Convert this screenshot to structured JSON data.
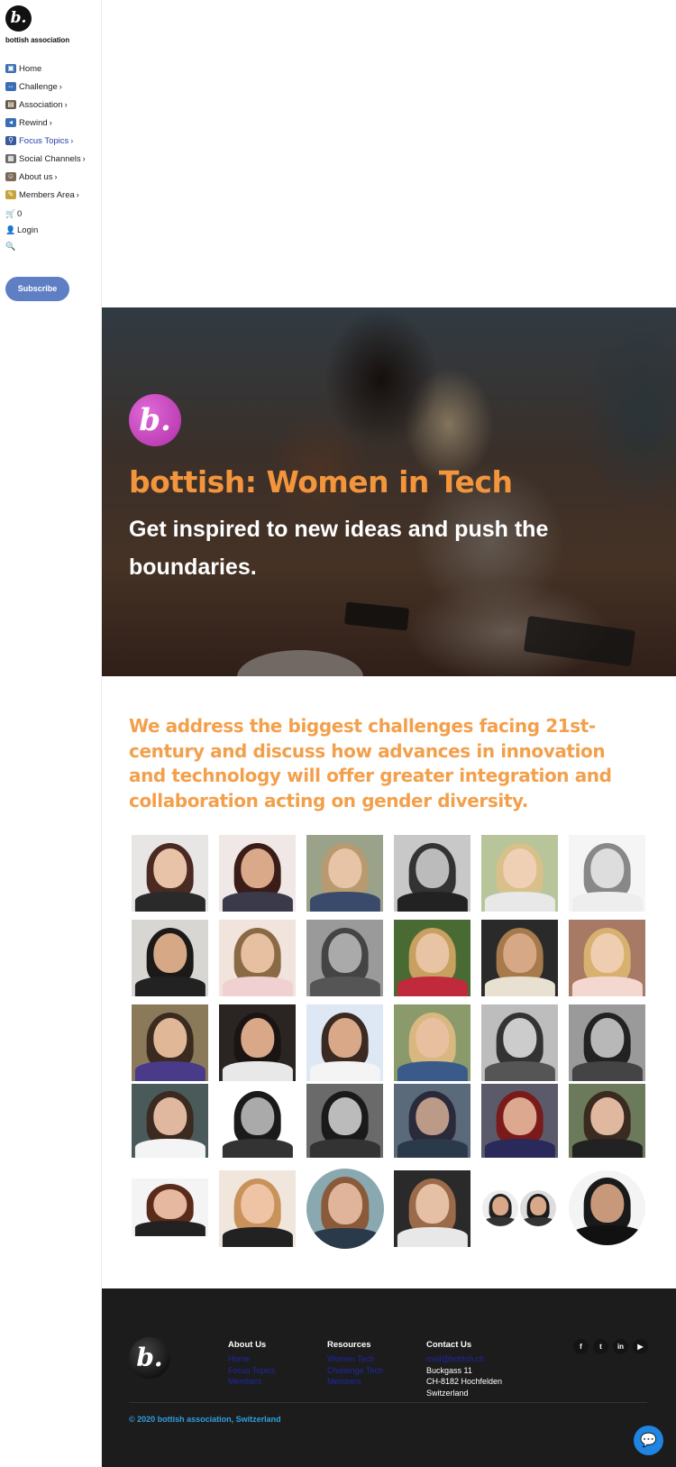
{
  "sidebar": {
    "logo_letter": "b.",
    "brand": "bottish association",
    "nav": [
      {
        "label": "Home",
        "icon": "home-icon",
        "color": "#3a6fb5",
        "chev": false,
        "active": false
      },
      {
        "label": "Challenge",
        "icon": "challenge-icon",
        "color": "#3a6fb5",
        "chev": true,
        "active": false
      },
      {
        "label": "Association",
        "icon": "association-icon",
        "color": "#6a5a4a",
        "chev": true,
        "active": false
      },
      {
        "label": "Rewind",
        "icon": "rewind-icon",
        "color": "#3a6fb5",
        "chev": true,
        "active": false
      },
      {
        "label": "Focus Topics",
        "icon": "magnifier-icon",
        "color": "#3a5a9a",
        "chev": true,
        "active": true
      },
      {
        "label": "Social Channels",
        "icon": "social-icon",
        "color": "#6a6a6a",
        "chev": true,
        "active": false
      },
      {
        "label": "About us",
        "icon": "about-icon",
        "color": "#7a6a5a",
        "chev": true,
        "active": false
      },
      {
        "label": "Members Area",
        "icon": "members-icon",
        "color": "#c8a23a",
        "chev": true,
        "active": false
      }
    ],
    "cart_count": "0",
    "login_label": "Login",
    "subscribe_label": "Subscribe"
  },
  "hero": {
    "logo_letter": "b.",
    "title": "bottish: Women in Tech",
    "subtitle": "Get inspired to new ideas and push the boundaries."
  },
  "mission": "We address the biggest challenges facing 21st-century and discuss how advances in innovation and technology will offer greater integration and collaboration acting on gender diversity.",
  "footer": {
    "logo_letter": "b.",
    "about": {
      "heading": "About Us",
      "links": [
        "Home",
        "Focus Topics",
        "Members"
      ]
    },
    "resources": {
      "heading": "Resources",
      "links": [
        "Women Tech",
        "Challenge Tech",
        "Members"
      ]
    },
    "contact": {
      "heading": "Contact Us",
      "email": "mail@bottish.ch",
      "street": "Buckgass 11",
      "city": "CH-8182 Hochfelden",
      "country": "Switzerland"
    },
    "socials": [
      "facebook-icon",
      "twitter-icon",
      "linkedin-icon",
      "youtube-icon"
    ],
    "copyright": "© 2020 bottish association, Switzerland"
  },
  "colors": {
    "accent_orange": "#f3953d",
    "subscribe_blue": "#5f7fc4",
    "footer_bg": "#1c1c1c",
    "chat_blue": "#1f84e2"
  }
}
